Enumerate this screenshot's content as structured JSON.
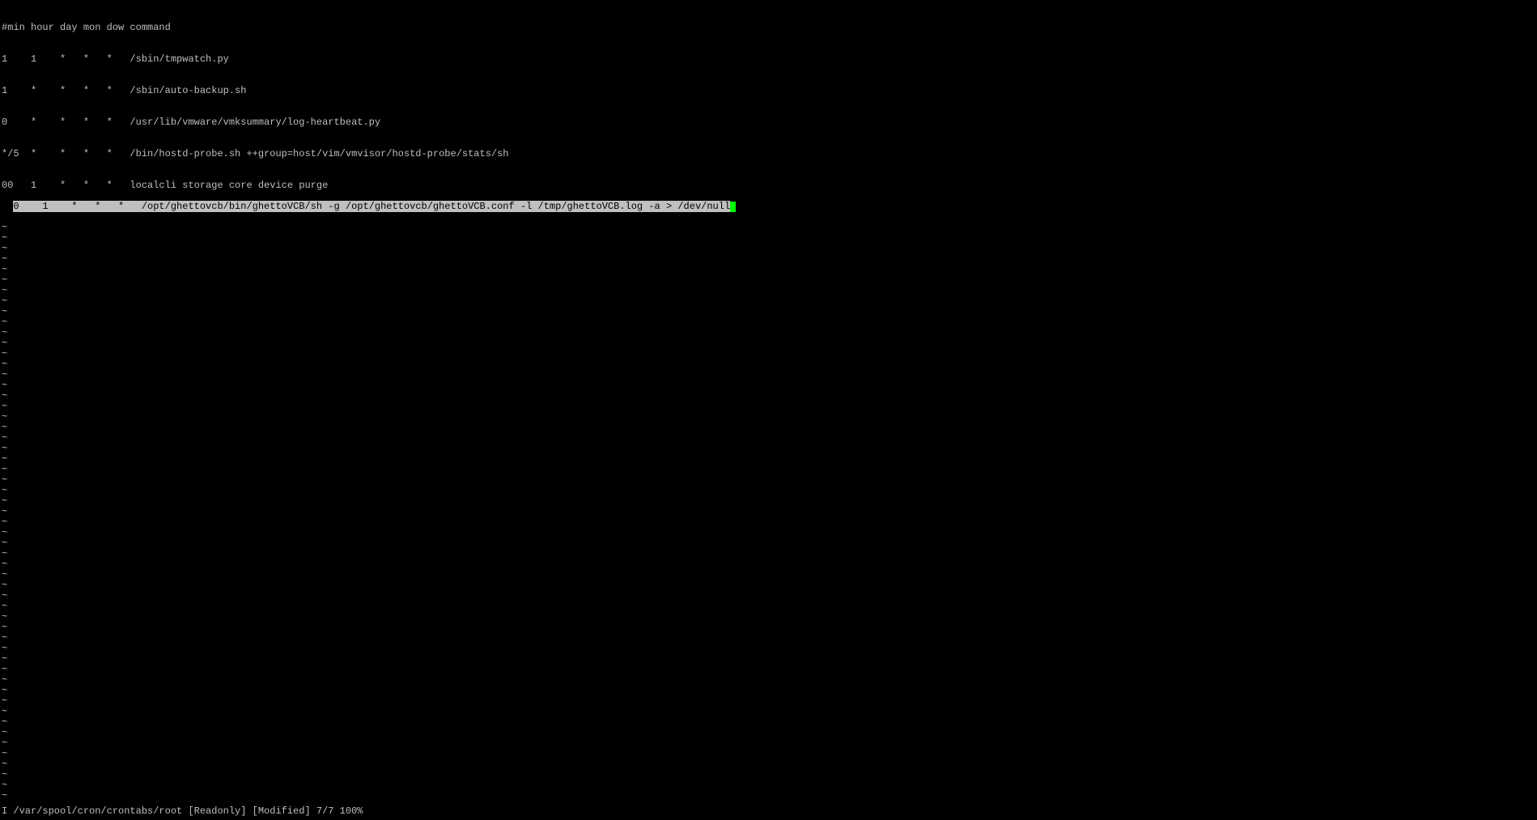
{
  "lines": [
    "#min hour day mon dow command",
    "1    1    *   *   *   /sbin/tmpwatch.py",
    "1    *    *   *   *   /sbin/auto-backup.sh",
    "0    *    *   *   *   /usr/lib/vmware/vmksummary/log-heartbeat.py",
    "*/5  *    *   *   *   /bin/hostd-probe.sh ++group=host/vim/vmvisor/hostd-probe/stats/sh",
    "00   1    *   *   *   localcli storage core device purge"
  ],
  "highlighted_line": "0    1    *   *   *   /opt/ghettovcb/bin/ghettoVCB/sh -g /opt/ghettovcb/ghettoVCB.conf -l /tmp/ghettoVCB.log -a > /dev/null",
  "tilde_char": "~",
  "tilde_count": 55,
  "status_bar": "I /var/spool/cron/crontabs/root [Readonly] [Modified] 7/7 100%"
}
